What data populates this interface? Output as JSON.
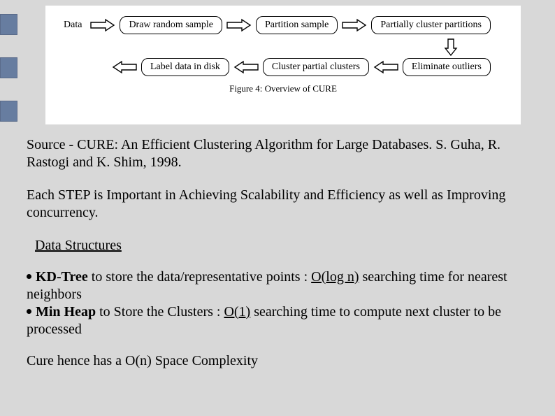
{
  "sidebar": {
    "visible": true
  },
  "figure": {
    "row1": {
      "data": "Data",
      "box1": "Draw random sample",
      "box2": "Partition sample",
      "box3": "Partially cluster partitions"
    },
    "row2": {
      "box1": "Label data in disk",
      "box2": "Cluster partial clusters",
      "box3": "Eliminate outliers"
    },
    "caption": "Figure 4: Overview of CURE"
  },
  "source_text": "Source - CURE: An Efficient Clustering Algorithm for Large Databases. S. Guha, R. Rastogi and K. Shim, 1998.",
  "step_text": "Each STEP is Important in Achieving Scalability and Efficiency as well as Improving concurrency.",
  "section_heading": "Data Structures",
  "bullets": {
    "b1_bold": "KD-Tree",
    "b1_mid": " to store the data/representative points : ",
    "b1_ul": "O(log n)",
    "b1_tail": " searching time for nearest neighbors",
    "b2_bold": "Min Heap",
    "b2_mid": " to Store the Clusters : ",
    "b2_ul": "O(1)",
    "b2_tail": " searching time to compute next cluster to be processed"
  },
  "conclusion": "Cure hence has a O(n) Space Complexity"
}
